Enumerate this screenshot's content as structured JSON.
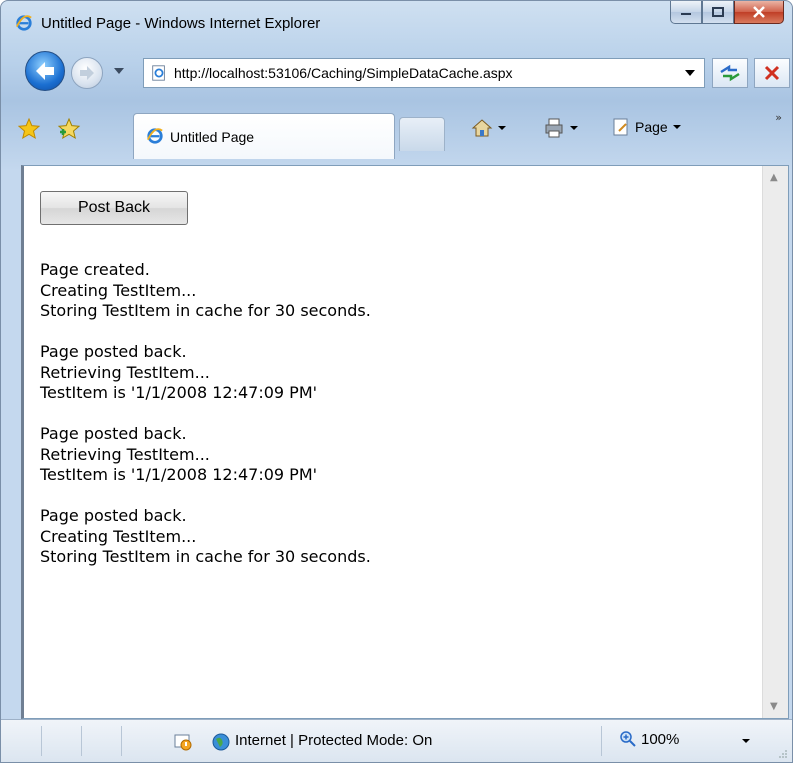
{
  "window": {
    "title": "Untitled Page - Windows Internet Explorer"
  },
  "address": {
    "url": "http://localhost:53106/Caching/SimpleDataCache.aspx"
  },
  "tab": {
    "label": "Untitled Page"
  },
  "commands": {
    "page_label": "Page",
    "more": "»"
  },
  "content": {
    "button_label": "Post Back",
    "log": [
      [
        "Page created.",
        "Creating TestItem...",
        "Storing TestItem in cache for 30 seconds."
      ],
      [
        "Page posted back.",
        "Retrieving TestItem...",
        "TestItem is '1/1/2008 12:47:09 PM'"
      ],
      [
        "Page posted back.",
        "Retrieving TestItem...",
        "TestItem is '1/1/2008 12:47:09 PM'"
      ],
      [
        "Page posted back.",
        "Creating TestItem...",
        "Storing TestItem in cache for 30 seconds."
      ]
    ]
  },
  "status": {
    "zone": "Internet | Protected Mode: On",
    "zoom": "100%"
  },
  "icons": {
    "browser": "ie-icon",
    "minimize": "minimize-icon",
    "maximize": "maximize-icon",
    "close": "close-icon"
  }
}
